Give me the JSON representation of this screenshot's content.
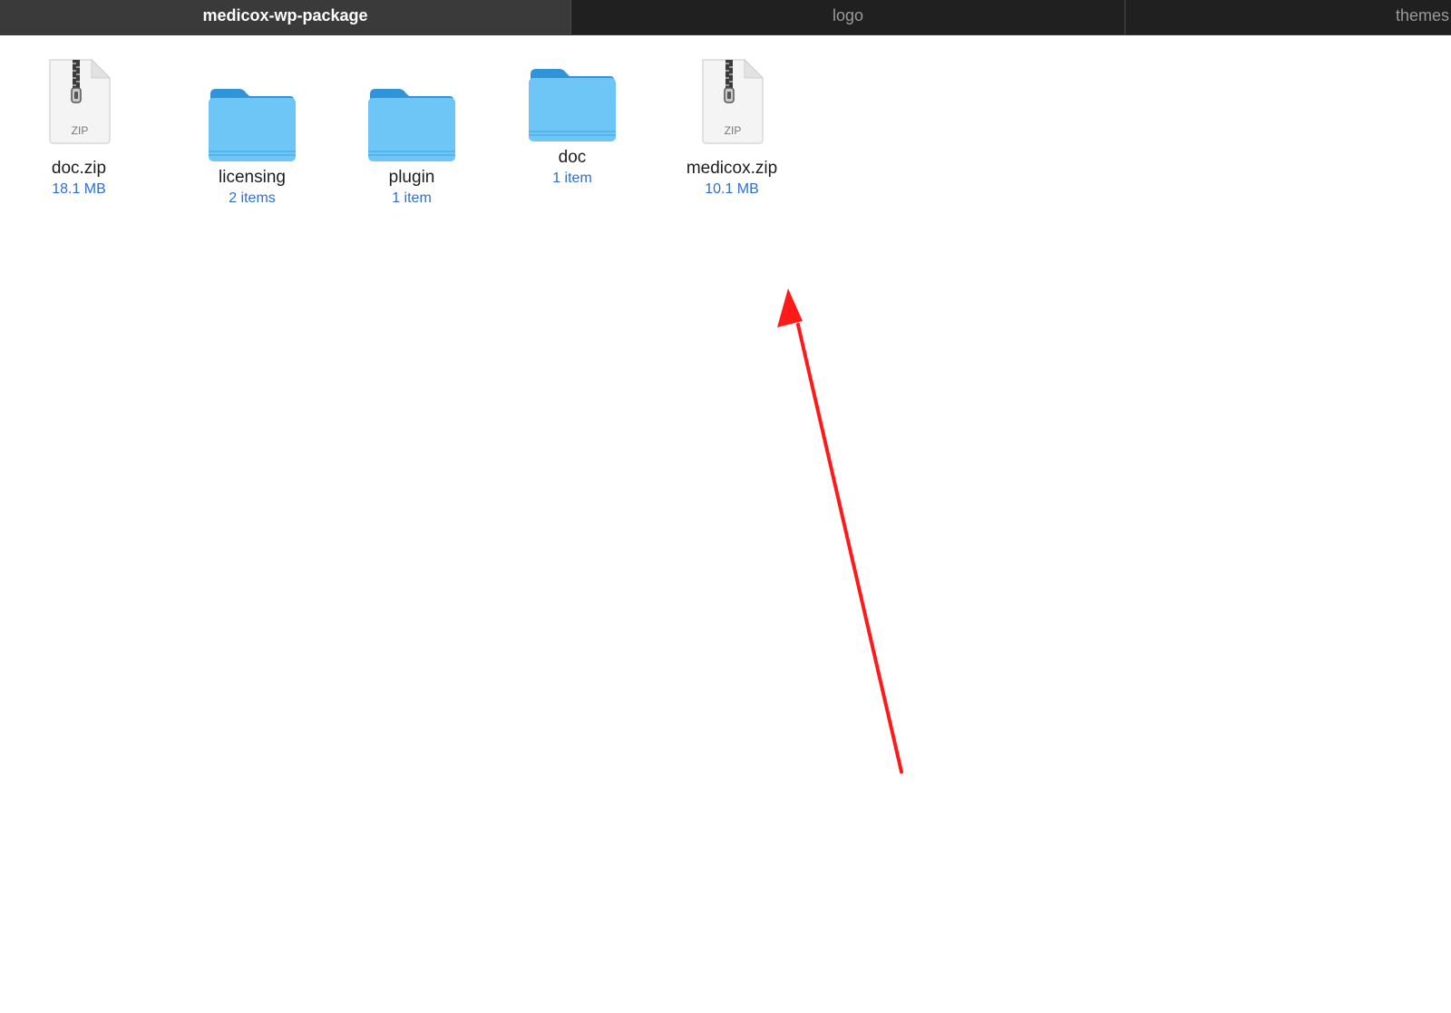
{
  "tabs": [
    {
      "label": "medicox-wp-package",
      "active": true
    },
    {
      "label": "logo",
      "active": false
    },
    {
      "label": "themes",
      "active": false
    }
  ],
  "files": [
    {
      "name": "doc.zip",
      "meta": "18.1 MB",
      "kind": "zip",
      "icon": "zip-archive-icon",
      "badge": "ZIP"
    },
    {
      "name": "licensing",
      "meta": "2 items",
      "kind": "folder",
      "icon": "folder-icon"
    },
    {
      "name": "plugin",
      "meta": "1 item",
      "kind": "folder",
      "icon": "folder-icon"
    },
    {
      "name": "doc",
      "meta": "1 item",
      "kind": "folder",
      "icon": "folder-icon"
    },
    {
      "name": "medicox.zip",
      "meta": "10.1 MB",
      "kind": "zip",
      "icon": "zip-archive-icon",
      "badge": "ZIP"
    }
  ],
  "colors": {
    "tab_bar": "#202020",
    "active_tab": "#3a3a3a",
    "folder": "#6ec6f7",
    "meta_text": "#2f6fd0",
    "annotation_arrow": "#ff1a1a"
  }
}
